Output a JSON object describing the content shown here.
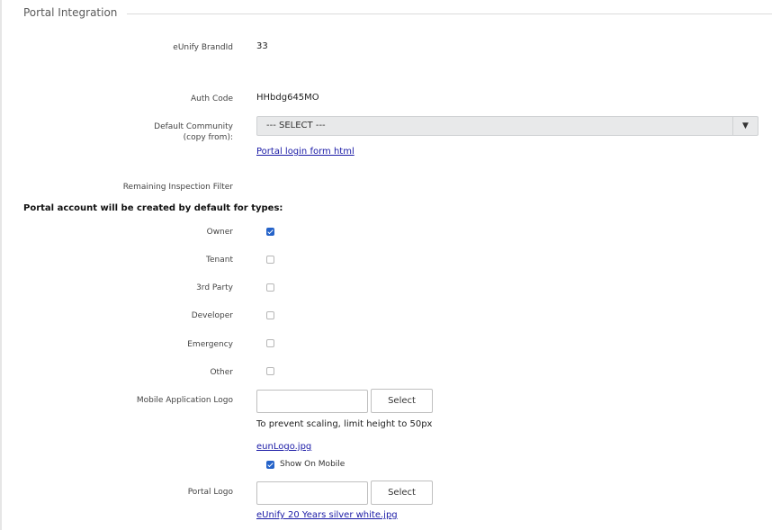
{
  "section": {
    "title": "Portal Integration"
  },
  "fields": {
    "brand_id": {
      "label": "eUnify BrandId",
      "value": "33"
    },
    "auth_code": {
      "label": "Auth Code",
      "value": "HHbdg645MO"
    },
    "default_community": {
      "label_line1": "Default Community",
      "label_line2": "(copy from):",
      "selected": "--- SELECT ---"
    },
    "portal_login_link": "Portal login form html",
    "remaining_filter": {
      "label": "Remaining Inspection Filter"
    }
  },
  "account_types": {
    "heading": "Portal account will be created by default for types:",
    "items": [
      {
        "label": "Owner",
        "checked": true
      },
      {
        "label": "Tenant",
        "checked": false
      },
      {
        "label": "3rd Party",
        "checked": false
      },
      {
        "label": "Developer",
        "checked": false
      },
      {
        "label": "Emergency",
        "checked": false
      },
      {
        "label": "Other",
        "checked": false
      }
    ]
  },
  "mobile_logo": {
    "label": "Mobile Application Logo",
    "button": "Select",
    "hint": "To prevent scaling, limit height to 50px",
    "file_link": "eunLogo.jpg",
    "show_on_mobile_label": "Show On Mobile",
    "show_on_mobile_checked": true
  },
  "portal_logo": {
    "label": "Portal Logo",
    "button": "Select",
    "file_link": "eUnify 20 Years silver white.jpg"
  },
  "colors": {
    "accent": "#2563c9",
    "link": "#1a1aa6",
    "select_bg": "#e8e9ea"
  }
}
